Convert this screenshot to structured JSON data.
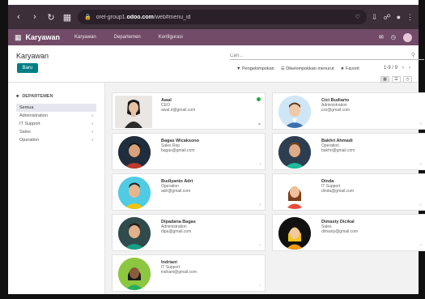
{
  "browser": {
    "url_prefix": "orel-group1.",
    "url_domain": "odoo.com",
    "url_suffix": "/web#menu_id"
  },
  "odoo": {
    "app_title": "Karyawan",
    "menu": [
      "Karyawan",
      "Departemen",
      "Konfigurasi"
    ]
  },
  "control": {
    "breadcrumb": "Karyawan",
    "new_label": "Baru",
    "search_placeholder": "Cari...",
    "filters": [
      "Pengelompokan",
      "Dikelompokkan menurut",
      "Favorit"
    ],
    "pager": "1-9 / 9"
  },
  "sidebar": {
    "title": "DEPARTEMEN",
    "items": [
      {
        "label": "Semua"
      },
      {
        "label": "Administration"
      },
      {
        "label": "IT Support"
      },
      {
        "label": "Sales"
      },
      {
        "label": "Operation"
      }
    ]
  },
  "employees": [
    {
      "name": "Awal",
      "job": "CEO",
      "email": "awal.d@gmail.com",
      "style": "woman_photo"
    },
    {
      "name": "Cici Budiarto",
      "job": "Administration",
      "email": "cici@gmail.com",
      "style": "man_blue"
    },
    {
      "name": "Bagas Wicaksono",
      "job": "Sales Rep",
      "email": "bagas@gmail.com",
      "style": "man_dark"
    },
    {
      "name": "Bakhri Ahmadi",
      "job": "Operation",
      "email": "bakhri@gmail.com",
      "style": "man_teal"
    },
    {
      "name": "Budiyanto Adri",
      "job": "Operation",
      "email": "adri@gmail.com",
      "style": "man_cyan"
    },
    {
      "name": "Dinda",
      "job": "IT Support",
      "email": "dinda@gmail.com",
      "style": "woman_red"
    },
    {
      "name": "Dipadana Bagas",
      "job": "Administration",
      "email": "dipa@gmail.com",
      "style": "man_green"
    },
    {
      "name": "Dimasty Dicikal",
      "job": "Sales",
      "email": "dimasty@gmail.com",
      "style": "woman_yellow"
    },
    {
      "name": "Indriani",
      "job": "IT Support",
      "email": "indriani@gmail.com",
      "style": "woman_green"
    }
  ]
}
